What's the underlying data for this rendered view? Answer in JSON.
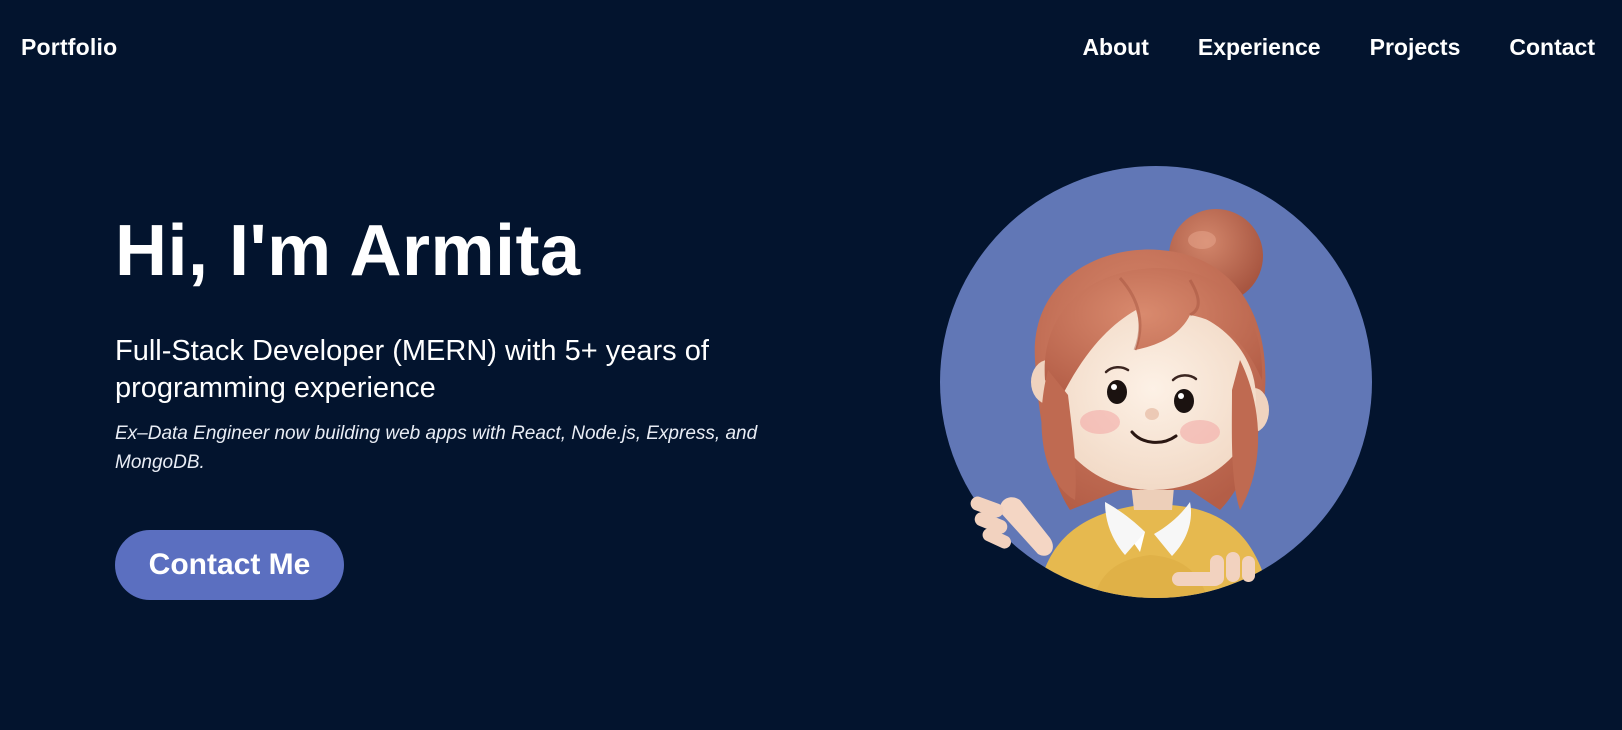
{
  "nav": {
    "brand": "Portfolio",
    "links": [
      {
        "label": "About"
      },
      {
        "label": "Experience"
      },
      {
        "label": "Projects"
      },
      {
        "label": "Contact"
      }
    ]
  },
  "hero": {
    "headline": "Hi, I'm Armita",
    "subheadline": "Full-Stack Developer (MERN) with 5+ years of programming experience",
    "tagline": "Ex–Data Engineer now building web apps with React, Node.js, Express, and MongoDB.",
    "cta_label": "Contact Me"
  },
  "colors": {
    "background": "#03142e",
    "accent": "#5b6fc0",
    "avatar_circle": "#6177b6",
    "text": "#ffffff"
  },
  "icons": {
    "avatar": "cartoon-girl-avatar"
  }
}
